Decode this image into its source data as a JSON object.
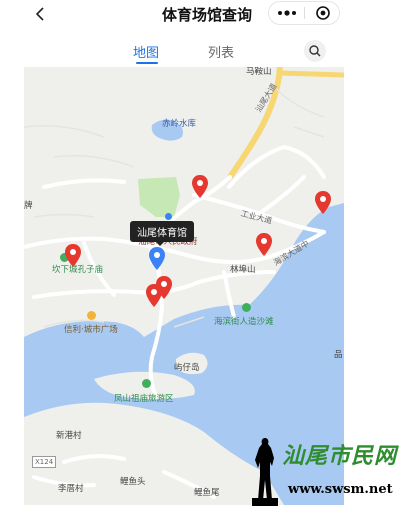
{
  "nav": {
    "title": "体育场馆查询",
    "back_icon": "chevron-left-icon",
    "more_icon": "more-dots-icon",
    "close_icon": "target-close-icon"
  },
  "tabs": [
    {
      "label": "地图",
      "active": true
    },
    {
      "label": "列表",
      "active": false
    }
  ],
  "search_icon": "search-icon",
  "map": {
    "tooltip": "汕尾体育馆",
    "labels": {
      "maanshan": "马鞍山",
      "shanweidadao": "汕尾大道",
      "chilingshuiku": "赤岭水库",
      "pai": "牌",
      "gongyedadao": "工业大道",
      "haibindadao": "海滨大道中",
      "gov": "汕尾市人民政府",
      "linzhangshan": "林埠山",
      "kongzimiao": "坎下城孔子庙",
      "xinli": "信利·城市广场",
      "haibinjie": "海滨街人造沙滩",
      "shazaidao": "屿仔岛",
      "fengshan": "凤山祖庙旅游区",
      "xingangcun": "新港村",
      "x124": "X124",
      "liliaocun": "李厝村",
      "guiyutou": "鲤鱼头",
      "guiyuwei": "鲤鱼尾",
      "pin": "品"
    }
  },
  "watermark": {
    "text": "汕尾市民网",
    "url": "www.swsm.net"
  },
  "colors": {
    "accent": "#1a73e8",
    "pin_red": "#e5382f",
    "pin_blue": "#3b82f6",
    "water": "#a8c9f2",
    "land": "#eff0ec",
    "park": "#c6e8b4",
    "highway": "#f7d774"
  }
}
